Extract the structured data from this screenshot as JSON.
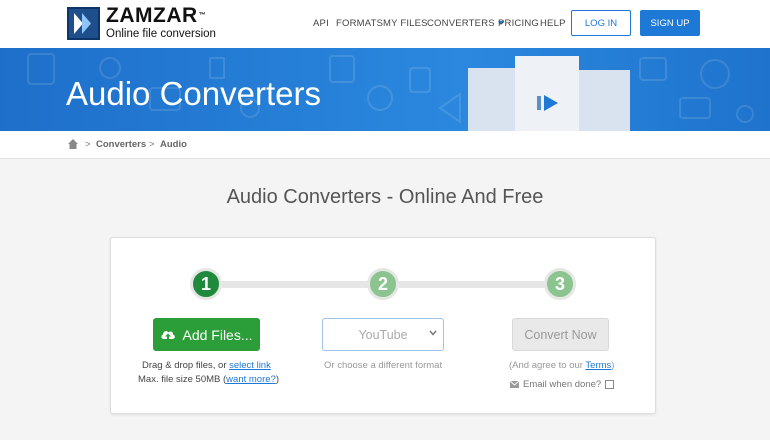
{
  "header": {
    "brand": "ZAMZAR",
    "trademark": "™",
    "tagline": "Online file conversion",
    "nav": [
      {
        "label": "API"
      },
      {
        "label": "FORMATS"
      },
      {
        "label": "MY FILES"
      },
      {
        "label": "CONVERTERS"
      },
      {
        "label": "PRICING"
      },
      {
        "label": "HELP"
      }
    ],
    "login_label": "LOG IN",
    "signup_label": "SIGN UP"
  },
  "banner": {
    "title": "Audio Converters"
  },
  "breadcrumb": {
    "separator": ">",
    "items": [
      {
        "label": "Converters"
      },
      {
        "label": "Audio"
      }
    ]
  },
  "main": {
    "heading": "Audio Converters - Online And Free"
  },
  "steps": [
    {
      "number": "1"
    },
    {
      "number": "2"
    },
    {
      "number": "3"
    }
  ],
  "step1": {
    "button_label": "Add Files...",
    "hint_prefix": "Drag & drop files, or ",
    "select_link": "select link",
    "size_prefix": "Max. file size 50MB (",
    "want_more": "want more?",
    "size_suffix": ")"
  },
  "step2": {
    "selected_format": "YouTube",
    "hint": "Or choose a different format"
  },
  "step3": {
    "button_label": "Convert Now",
    "agree_prefix": "(And agree to our ",
    "terms_link": "Terms",
    "agree_suffix": ")",
    "email_label": "Email when done?"
  },
  "colors": {
    "primary_blue": "#1e78d6",
    "active_green": "#1f8a3b",
    "pending_green": "#8bc48e",
    "add_button_green": "#2b9e3a"
  }
}
